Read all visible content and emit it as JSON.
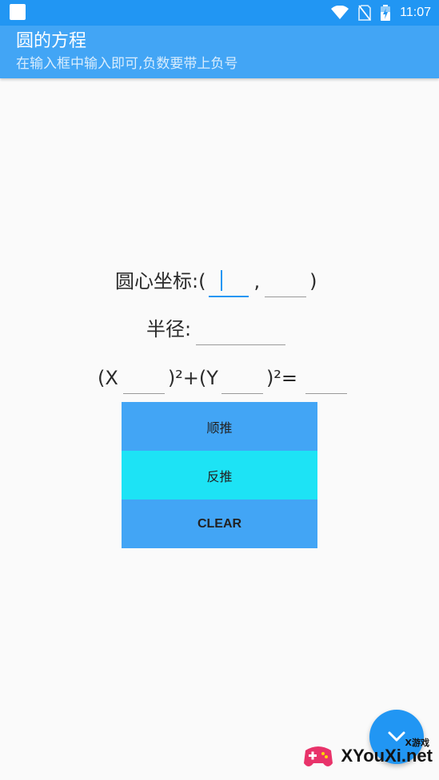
{
  "status_bar": {
    "time": "11:07",
    "icons": [
      "notification-icon",
      "wifi-icon",
      "no-sim-icon",
      "battery-icon"
    ]
  },
  "app_bar": {
    "title": "圆的方程",
    "subtitle": "在输入框中输入即可,负数要带上负号"
  },
  "form": {
    "center": {
      "label": "圆心坐标:(",
      "comma": ",",
      "close_paren": ")",
      "x_value": "",
      "y_value": ""
    },
    "radius": {
      "label": "半径:",
      "value": ""
    },
    "equation": {
      "prefix": "(X",
      "middle": ")²+(Y",
      "suffix": ")²=",
      "a_value": "",
      "b_value": "",
      "r2_value": ""
    }
  },
  "buttons": {
    "forward": "顺推",
    "reverse": "反推",
    "clear": "CLEAR"
  },
  "watermark": {
    "small": "X游戏",
    "big": "XYouXi.net"
  },
  "colors": {
    "status_bar": "#2196f3",
    "app_bar": "#42a5f5",
    "button_blue": "#42a5f5",
    "button_cyan": "#1de3f5",
    "fab": "#2196f3"
  }
}
